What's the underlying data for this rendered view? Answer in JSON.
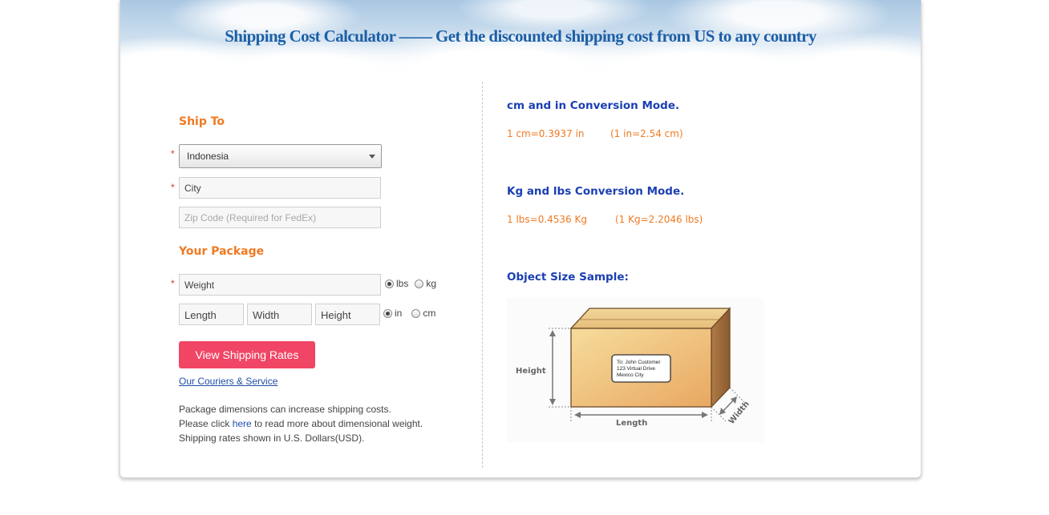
{
  "header": {
    "title": "Shipping Cost Calculator —— Get the discounted shipping cost from US to any country"
  },
  "ship_to": {
    "section_title": "Ship To",
    "country_value": "Indonesia",
    "city_placeholder": "City",
    "zip_placeholder": "Zip Code (Required for FedEx)"
  },
  "package": {
    "section_title": "Your Package",
    "weight_placeholder": "Weight",
    "weight_units": [
      {
        "label": "lbs",
        "selected": true
      },
      {
        "label": "kg",
        "selected": false
      }
    ],
    "length_placeholder": "Length",
    "width_placeholder": "Width",
    "height_placeholder": "Height",
    "dim_units": [
      {
        "label": "in",
        "selected": true
      },
      {
        "label": "cm",
        "selected": false
      }
    ]
  },
  "required_mark": "*",
  "actions": {
    "view_rates_label": "View Shipping Rates",
    "couriers_link": "Our Couriers & Service"
  },
  "notes": {
    "line1": "Package dimensions can increase shipping costs.",
    "line2_pre": "Please click ",
    "line2_link": "here",
    "line2_post": " to read more about dimensional weight.",
    "line3": "Shipping rates shown in U.S. Dollars(USD)."
  },
  "conversions": {
    "length_title": "cm and in Conversion Mode.",
    "length_a": "1 cm=0.3937 in",
    "length_b": "(1 in=2.54 cm)",
    "weight_title": "Kg and lbs Conversion Mode.",
    "weight_a": "1 lbs=0.4536 Kg",
    "weight_b": "(1 Kg=2.2046 lbs)",
    "sample_title": "Object Size Sample:"
  },
  "box_sample": {
    "label_line1": "To: John Customer",
    "label_line2": "123 Virtual Drive",
    "label_line3": "Mexico City",
    "height_label": "Height",
    "length_label": "Length",
    "width_label": "Width"
  },
  "colors": {
    "accent_orange": "#f07a22",
    "title_blue": "#1d5fa6",
    "mode_blue": "#1b3fb3",
    "button_pink": "#f04565"
  }
}
